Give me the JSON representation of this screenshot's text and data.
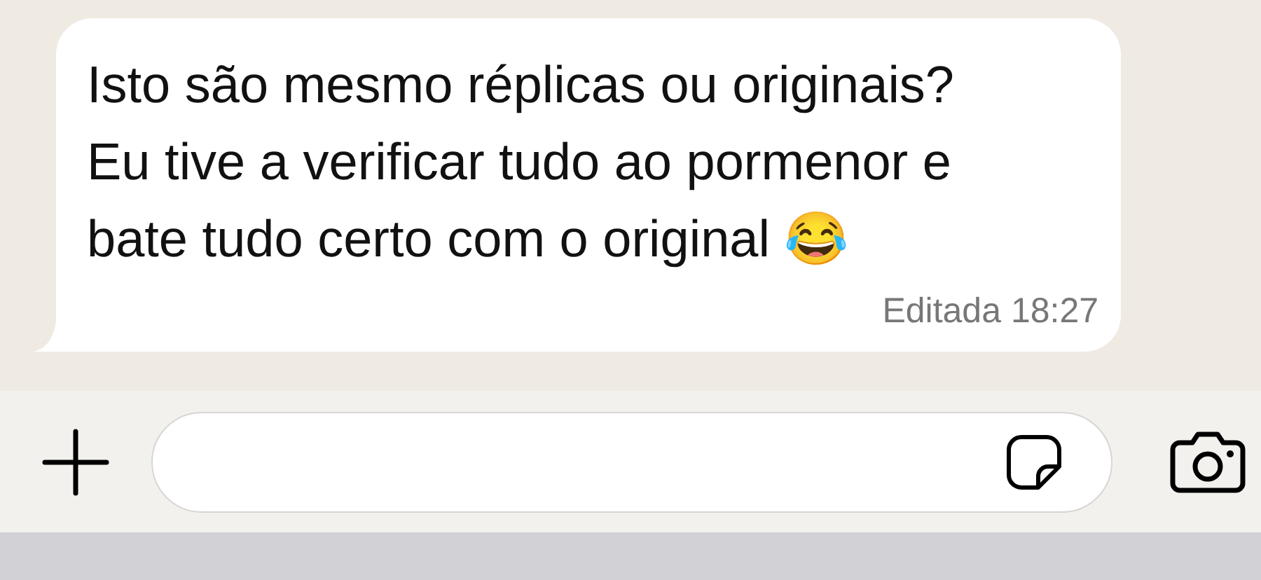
{
  "message": {
    "lines": [
      "Isto são mesmo réplicas ou originais?",
      "Eu tive a verificar tudo ao pormenor e",
      "bate tudo certo com o original 😂"
    ],
    "footer": "Editada 18:27"
  }
}
